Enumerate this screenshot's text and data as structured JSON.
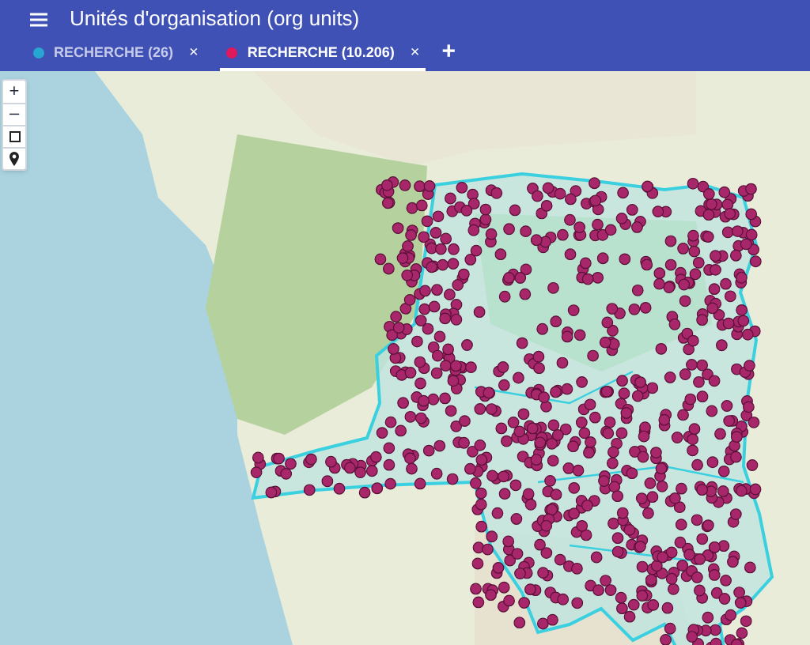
{
  "app_bar": {
    "title": "Unités d'organisation (org units)"
  },
  "tabs": [
    {
      "label": "RECHERCHE (26)",
      "color": "#26a6d1",
      "close": "×",
      "selected": false
    },
    {
      "label": "RECHERCHE (10.206)",
      "color": "#e0185c",
      "close": "×",
      "selected": true
    }
  ],
  "add_tab": "+",
  "map_controls": [
    {
      "kind": "text",
      "label": "+"
    },
    {
      "kind": "text",
      "label": "–"
    },
    {
      "kind": "square"
    },
    {
      "kind": "pin"
    }
  ]
}
